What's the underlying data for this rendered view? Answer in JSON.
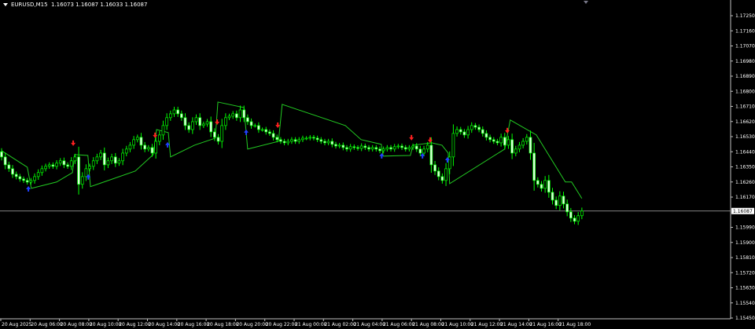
{
  "header": {
    "symbol": "EURUSD,M15",
    "ohlc": "1.16073 1.16087 1.16033 1.16087"
  },
  "colors": {
    "background": "#000000",
    "axis": "#c0c0c0",
    "candle": "#00ff00",
    "bear_fill": "#ffffff",
    "indicator": "#22cc22",
    "sell_arrow": "#ff2020",
    "buy_arrow": "#2040ff",
    "bid_line": "#b0b0b0"
  },
  "chart_data": {
    "type": "candlestick",
    "timeframe": "M15",
    "price_axis": {
      "ticks": [
        "1.17250",
        "1.17160",
        "1.17070",
        "1.16980",
        "1.16890",
        "1.16800",
        "1.16710",
        "1.16620",
        "1.16530",
        "1.16440",
        "1.16350",
        "1.16260",
        "1.16170",
        "1.15990",
        "1.15900",
        "1.15810",
        "1.15720",
        "1.15630",
        "1.15540",
        "1.15450"
      ],
      "current_price": "1.16087"
    },
    "time_axis": {
      "ticks": [
        "20 Aug 2025",
        "20 Aug 06:00",
        "20 Aug 08:00",
        "20 Aug 10:00",
        "20 Aug 12:00",
        "20 Aug 14:00",
        "20 Aug 16:00",
        "20 Aug 18:00",
        "20 Aug 20:00",
        "20 Aug 22:00",
        "21 Aug 00:00",
        "21 Aug 02:00",
        "21 Aug 04:00",
        "21 Aug 06:00",
        "21 Aug 08:00",
        "21 Aug 10:00",
        "21 Aug 12:00",
        "21 Aug 14:00",
        "21 Aug 16:00",
        "21 Aug 18:00"
      ],
      "bars_per_tick": 8
    },
    "first_open": 1.1644,
    "closes": [
      1.16409,
      1.16362,
      1.16339,
      1.16306,
      1.16292,
      1.16278,
      1.16269,
      1.16259,
      1.16269,
      1.16292,
      1.16316,
      1.16339,
      1.16353,
      1.16362,
      1.16353,
      1.16372,
      1.16386,
      1.16362,
      1.16353,
      1.16386,
      1.16409,
      1.16246,
      1.16292,
      1.16339,
      1.16353,
      1.16386,
      1.16409,
      1.16432,
      1.16362,
      1.16386,
      1.16409,
      1.16372,
      1.16386,
      1.16432,
      1.16456,
      1.16479,
      1.16512,
      1.16526,
      1.16479,
      1.16456,
      1.16465,
      1.16432,
      1.16502,
      1.1654,
      1.16596,
      1.16643,
      1.16666,
      1.16689,
      1.16666,
      1.16643,
      1.16596,
      1.16572,
      1.16619,
      1.16643,
      1.16596,
      1.16605,
      1.16619,
      1.16558,
      1.16526,
      1.16502,
      1.16596,
      1.16643,
      1.16652,
      1.16666,
      1.16643,
      1.16689,
      1.16643,
      1.16619,
      1.16596,
      1.16596,
      1.16572,
      1.16572,
      1.16558,
      1.16549,
      1.16526,
      1.16512,
      1.16502,
      1.16493,
      1.16502,
      1.16512,
      1.16502,
      1.16512,
      1.16521,
      1.16521,
      1.16526,
      1.16521,
      1.16512,
      1.16502,
      1.16493,
      1.16502,
      1.16484,
      1.16474,
      1.16479,
      1.16465,
      1.16456,
      1.1647,
      1.16465,
      1.1646,
      1.16474,
      1.16465,
      1.16456,
      1.16465,
      1.16456,
      1.16446,
      1.16456,
      1.16465,
      1.16456,
      1.1647,
      1.16474,
      1.16465,
      1.16456,
      1.16465,
      1.16474,
      1.16456,
      1.16432,
      1.16456,
      1.16479,
      1.16362,
      1.16325,
      1.16292,
      1.16269,
      1.16339,
      1.16409,
      1.16549,
      1.16572,
      1.16558,
      1.1654,
      1.16572,
      1.16596,
      1.16586,
      1.16572,
      1.16549,
      1.16526,
      1.16512,
      1.16502,
      1.16493,
      1.16526,
      1.16479,
      1.16512,
      1.16432,
      1.16456,
      1.16479,
      1.16502,
      1.16526,
      1.16432,
      1.16269,
      1.16246,
      1.16222,
      1.16269,
      1.16199,
      1.16152,
      1.1612,
      1.16176,
      1.16129,
      1.16082,
      1.16045,
      1.16026,
      1.16059,
      1.16087
    ],
    "indicator_line": [
      [
        0,
        1.16446
      ],
      [
        7,
        1.16348
      ],
      [
        8.1,
        1.16222
      ],
      [
        15,
        1.1626
      ],
      [
        19.3,
        1.16316
      ],
      [
        19.9,
        1.16423
      ],
      [
        23.5,
        1.16418
      ],
      [
        24.2,
        1.16232
      ],
      [
        36.4,
        1.16325
      ],
      [
        41.3,
        1.16423
      ],
      [
        42.2,
        1.16572
      ],
      [
        45.4,
        1.16554
      ],
      [
        46,
        1.16409
      ],
      [
        52.5,
        1.16479
      ],
      [
        58.2,
        1.16521
      ],
      [
        58.9,
        1.16736
      ],
      [
        66,
        1.16703
      ],
      [
        67,
        1.16456
      ],
      [
        75.4,
        1.16502
      ],
      [
        76.4,
        1.16722
      ],
      [
        93.6,
        1.16596
      ],
      [
        97.9,
        1.16512
      ],
      [
        103.4,
        1.16484
      ],
      [
        103.9,
        1.16414
      ],
      [
        111.3,
        1.16418
      ],
      [
        112,
        1.16479
      ],
      [
        117.1,
        1.16493
      ],
      [
        119.9,
        1.16479
      ],
      [
        121.6,
        1.16432
      ],
      [
        122,
        1.1625
      ],
      [
        137,
        1.16456
      ],
      [
        138.5,
        1.16629
      ],
      [
        145.6,
        1.1654
      ],
      [
        153.5,
        1.1626
      ],
      [
        155.2,
        1.1626
      ],
      [
        158,
        1.16162
      ]
    ],
    "sell_arrows": [
      [
        19.5,
        1.16451
      ],
      [
        41.8,
        1.16498
      ],
      [
        58.7,
        1.16577
      ],
      [
        75.2,
        1.16558
      ],
      [
        111.6,
        1.16484
      ],
      [
        116.7,
        1.1647
      ],
      [
        137.7,
        1.16526
      ]
    ],
    "buy_arrows": [
      [
        7.3,
        1.16259
      ],
      [
        23.6,
        1.1633
      ],
      [
        45.2,
        1.16521
      ],
      [
        66.6,
        1.16596
      ],
      [
        103.5,
        1.16456
      ],
      [
        114.6,
        1.16456
      ],
      [
        121.4,
        1.16432
      ]
    ]
  }
}
